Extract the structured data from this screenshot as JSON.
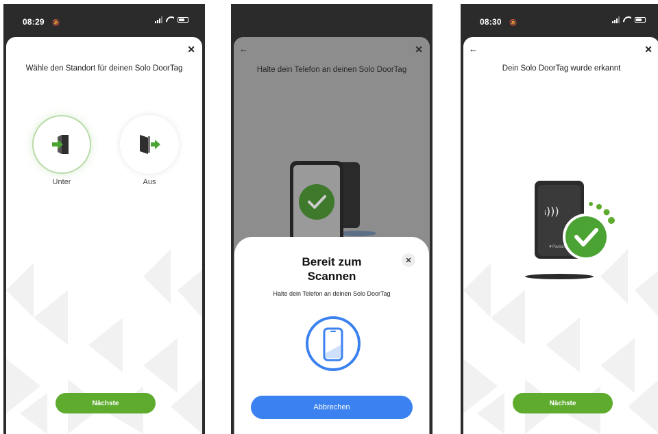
{
  "screens": [
    {
      "status": {
        "time": "08:29"
      },
      "title": "Wähle den Standort für deinen Solo DoorTag",
      "options": [
        {
          "label": "Unter",
          "selected": true
        },
        {
          "label": "Aus",
          "selected": false
        }
      ],
      "next_label": "Nächste"
    },
    {
      "title": "Halte dein Telefon an deinen Solo DoorTag",
      "modal": {
        "title_line1": "Bereit zum",
        "title_line2": "Scannen",
        "subtitle": "Halte dein Telefon an deinen Solo DoorTag",
        "cancel_label": "Abbrechen"
      }
    },
    {
      "status": {
        "time": "08:30"
      },
      "title": "Dein Solo DoorTag wurde erkannt",
      "next_label": "Nächste"
    }
  ],
  "colors": {
    "brand_green": "#5eab2e",
    "cancel_blue": "#3b82f0",
    "scan_ring_blue": "#3b82f0"
  },
  "icons": [
    "close-icon",
    "back-arrow-icon",
    "door-enter-icon",
    "door-exit-icon",
    "phone-icon",
    "checkmark-icon",
    "nfc-icon"
  ]
}
